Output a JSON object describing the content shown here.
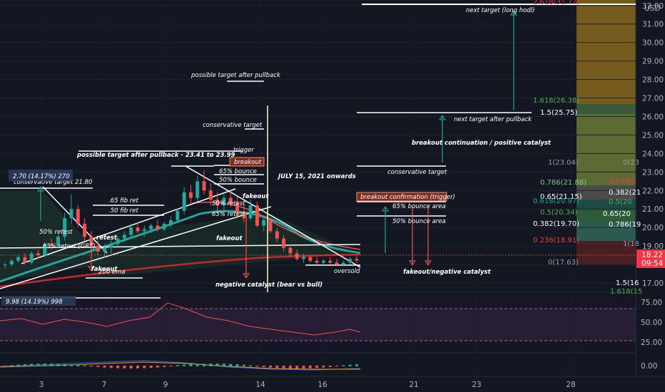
{
  "currency": "USD",
  "price_badge": {
    "price": "18.22",
    "countdown": "09:54"
  },
  "price_axis": [
    "32.00",
    "31.00",
    "30.00",
    "29.00",
    "28.00",
    "27.00",
    "26.00",
    "25.00",
    "24.00",
    "23.00",
    "22.00",
    "21.00",
    "20.00",
    "19.00",
    "18.00",
    "17.00"
  ],
  "time_axis": [
    "3",
    "7",
    "9",
    "14",
    "16",
    "21",
    "23",
    "28"
  ],
  "rsi_axis": [
    "75.00",
    "50.00",
    "25.00"
  ],
  "macd_axis": [
    "0.00"
  ],
  "fib_levels": [
    {
      "label": "2.618(31.77)",
      "color": "#f23645"
    },
    {
      "label": "1.618(26.38)",
      "color": "#4caf50"
    },
    {
      "label": "1.5(25.75)",
      "color": "#ffffff"
    },
    {
      "label": "1(23.04)",
      "color": "#9598a1"
    },
    {
      "label": "0.786(21.88)",
      "color": "#81c784"
    },
    {
      "label": "0.65(21.15)",
      "color": "#ffffff"
    },
    {
      "label": "0.618(20.97)",
      "color": "#26a69a"
    },
    {
      "label": "0.5(20.34)",
      "color": "#4caf50"
    },
    {
      "label": "0.382(19.70)",
      "color": "#ffffff"
    },
    {
      "label": "0.236(18.91)",
      "color": "#f23645"
    },
    {
      "label": "0(17.63)",
      "color": "#9598a1"
    }
  ],
  "fib_right_labels": [
    "0(23",
    "0.236(2",
    "0.382(21",
    "0.5(20",
    "0.65(20",
    "0.786(19",
    "1(18",
    "1.5(16",
    "1.618(15"
  ],
  "annotations": {
    "next_target_long": "next target (long hodl)",
    "next_target_pullback": "next target after pullback",
    "breakout_continuation": "breakout continuation / positive catalyst",
    "conservative_target_right": "conservative target",
    "breakout_confirmation": "breakout confirmation (trigger)",
    "bounce65_right": "65% bounce area",
    "bounce50_right": "50% bounce area",
    "fakeout_negative": "fakeout/negative catalyst",
    "possible_target_top": "possible target after pullback",
    "conservative_target_left": "conservative target",
    "trigger": "trigger",
    "breakout": "breakout",
    "bounce65": "65% bounce",
    "bounce50": "50% bounce",
    "possible_target_range": "possible target after pullback - 23.41 to 23.99",
    "july": "JULY 15, 2021 onwards",
    "fakeout1": "fakeout",
    "retest50": "50% retest",
    "retest65": "65% retest",
    "fakeout2": "fakeout",
    "negative_catalyst": "negative catalyst (bear vs bull)",
    "oversold": "oversold",
    "fib65": ".65 fib ret",
    "fib50": ".50 fib ret",
    "retest50_left": "50% retest",
    "retest_left": "retest",
    "retest65_left": "65% retest (GRT)",
    "fakeout_left": "fakeout",
    "ema200": "200 ema",
    "measure_label": "2.70 (14.17%) 270",
    "conservative_target_value": "conservative target 21.80",
    "rsi_measure": "9.98 (14.19%) 998"
  },
  "chart_data": {
    "type": "candlestick",
    "price_range": [
      16.5,
      32.3
    ],
    "candles": [
      [
        18.0,
        18.1,
        17.8,
        18.0
      ],
      [
        18.0,
        18.3,
        17.9,
        18.2
      ],
      [
        18.2,
        18.5,
        18.1,
        18.4
      ],
      [
        18.4,
        18.6,
        18.0,
        18.1
      ],
      [
        18.1,
        18.7,
        18.0,
        18.6
      ],
      [
        18.6,
        18.8,
        18.3,
        18.5
      ],
      [
        18.5,
        19.2,
        18.4,
        19.1
      ],
      [
        19.1,
        19.4,
        18.8,
        19.0
      ],
      [
        19.0,
        19.6,
        18.9,
        19.5
      ],
      [
        19.5,
        20.8,
        19.3,
        20.5
      ],
      [
        20.5,
        21.8,
        20.2,
        21.0
      ],
      [
        21.0,
        21.2,
        20.0,
        20.2
      ],
      [
        20.2,
        20.5,
        19.3,
        19.5
      ],
      [
        19.5,
        19.8,
        18.8,
        19.0
      ],
      [
        19.0,
        19.3,
        18.5,
        18.7
      ],
      [
        18.7,
        19.1,
        18.4,
        18.9
      ],
      [
        18.9,
        19.3,
        18.6,
        19.1
      ],
      [
        19.1,
        19.5,
        19.0,
        19.4
      ],
      [
        19.4,
        19.8,
        19.2,
        19.6
      ],
      [
        19.6,
        20.2,
        19.5,
        20.0
      ],
      [
        20.0,
        20.3,
        19.7,
        19.8
      ],
      [
        19.8,
        20.1,
        19.5,
        19.9
      ],
      [
        19.9,
        20.2,
        19.7,
        20.1
      ],
      [
        20.1,
        20.4,
        19.8,
        19.9
      ],
      [
        19.9,
        20.3,
        19.8,
        20.2
      ],
      [
        20.2,
        20.6,
        20.0,
        20.4
      ],
      [
        20.4,
        21.0,
        20.3,
        20.9
      ],
      [
        20.9,
        22.2,
        20.7,
        21.9
      ],
      [
        21.9,
        22.3,
        21.3,
        21.6
      ],
      [
        21.6,
        22.8,
        21.4,
        22.5
      ],
      [
        22.5,
        23.1,
        21.8,
        22.0
      ],
      [
        22.0,
        22.4,
        21.2,
        21.5
      ],
      [
        21.5,
        21.9,
        20.9,
        21.2
      ],
      [
        21.2,
        21.8,
        20.8,
        21.6
      ],
      [
        21.6,
        22.0,
        21.1,
        21.3
      ],
      [
        21.3,
        21.7,
        20.6,
        20.8
      ],
      [
        20.8,
        21.2,
        20.3,
        20.5
      ],
      [
        20.5,
        21.5,
        20.4,
        21.2
      ],
      [
        21.2,
        21.4,
        20.0,
        20.1
      ],
      [
        20.1,
        20.6,
        19.8,
        20.4
      ],
      [
        20.4,
        20.5,
        19.7,
        19.8
      ],
      [
        19.8,
        20.0,
        19.2,
        19.4
      ],
      [
        19.4,
        19.6,
        18.7,
        18.9
      ],
      [
        18.9,
        19.1,
        18.4,
        18.6
      ],
      [
        18.6,
        18.8,
        18.2,
        18.3
      ],
      [
        18.3,
        18.6,
        18.1,
        18.4
      ],
      [
        18.4,
        18.5,
        18.1,
        18.2
      ],
      [
        18.2,
        18.4,
        18.0,
        18.1
      ],
      [
        18.1,
        18.3,
        17.9,
        18.2
      ],
      [
        18.2,
        18.4,
        18.0,
        18.1
      ],
      [
        18.1,
        18.3,
        17.9,
        18.0
      ],
      [
        18.0,
        18.2,
        17.9,
        18.1
      ],
      [
        18.1,
        18.4,
        18.0,
        18.3
      ],
      [
        18.3,
        18.5,
        18.1,
        18.22
      ]
    ]
  }
}
